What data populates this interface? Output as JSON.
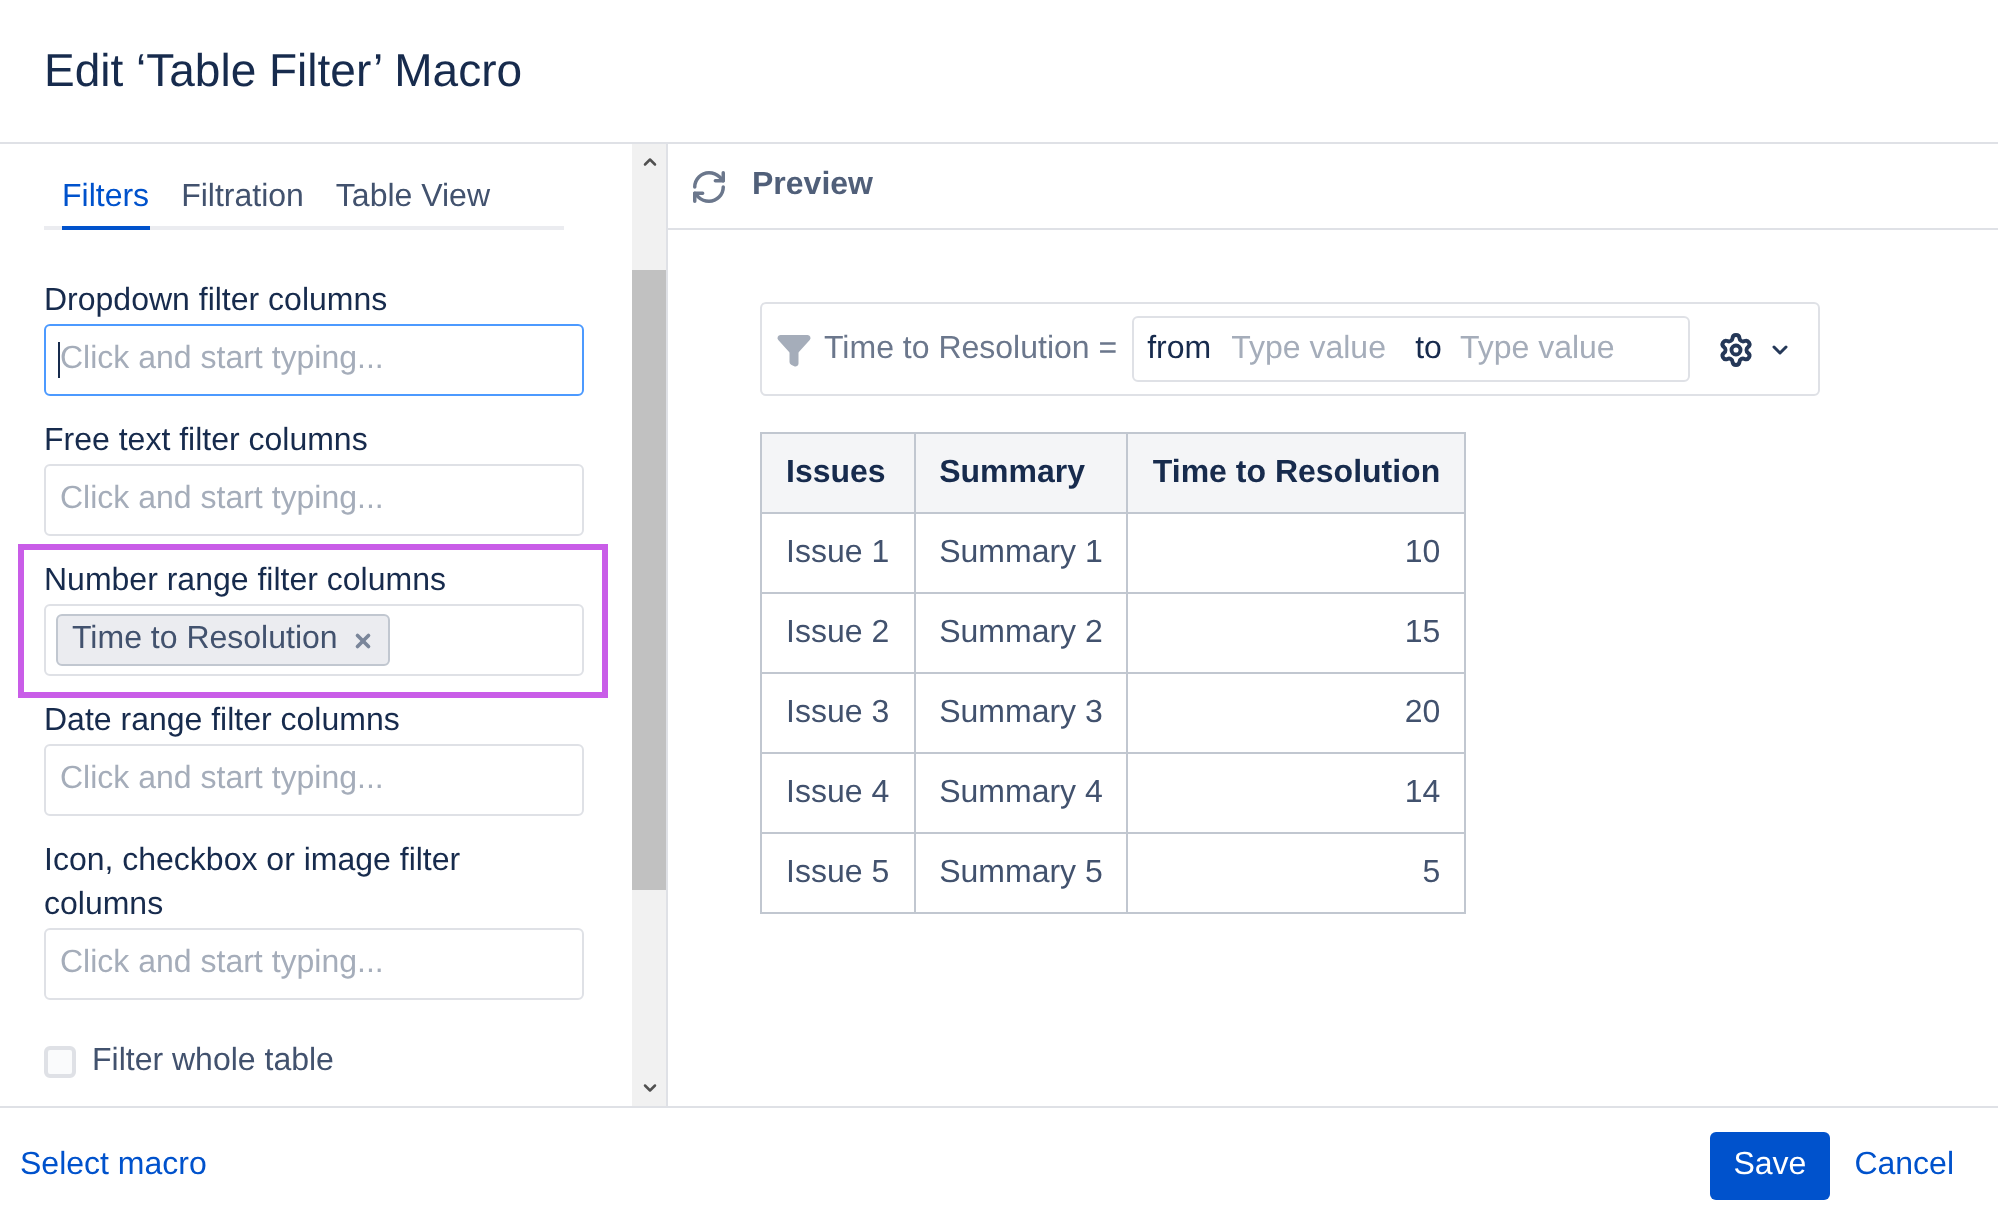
{
  "dialog": {
    "title": "Edit ‘Table Filter’ Macro"
  },
  "sidebar": {
    "tabs": [
      {
        "label": "Filters",
        "selected": true
      },
      {
        "label": "Filtration",
        "selected": false
      },
      {
        "label": "Table View",
        "selected": false
      }
    ],
    "fields": [
      {
        "label": "Dropdown filter columns",
        "placeholder": "Click and start typing...",
        "focused": true,
        "highlighted": false
      },
      {
        "label": "Free text filter columns",
        "placeholder": "Click and start typing...",
        "focused": false,
        "highlighted": false
      },
      {
        "label": "Number range filter columns",
        "tags": [
          "Time to Resolution"
        ],
        "focused": false,
        "highlighted": true
      },
      {
        "label": "Date range filter columns",
        "placeholder": "Click and start typing...",
        "focused": false,
        "highlighted": false
      },
      {
        "label": "Icon, checkbox or image filter columns",
        "placeholder": "Click and start typing...",
        "focused": false,
        "highlighted": false
      }
    ],
    "options": [
      {
        "label": "Filter whole table",
        "checked": false
      }
    ]
  },
  "preview": {
    "title": "Preview",
    "filter": {
      "column": "Time to Resolution =",
      "from_label": "from",
      "from_placeholder": "Type value",
      "to_label": "to",
      "to_placeholder": "Type value"
    },
    "table": {
      "columns": [
        "Issues",
        "Summary",
        "Time to Resolution"
      ],
      "rows": [
        [
          "Issue 1",
          "Summary 1",
          "10"
        ],
        [
          "Issue 2",
          "Summary 2",
          "15"
        ],
        [
          "Issue 3",
          "Summary 3",
          "20"
        ],
        [
          "Issue 4",
          "Summary 4",
          "14"
        ],
        [
          "Issue 5",
          "Summary 5",
          "5"
        ]
      ]
    }
  },
  "footer": {
    "link": "Select macro",
    "buttons": [
      {
        "label": "Save",
        "kind": "primary"
      },
      {
        "label": "Cancel",
        "kind": "link"
      }
    ]
  }
}
